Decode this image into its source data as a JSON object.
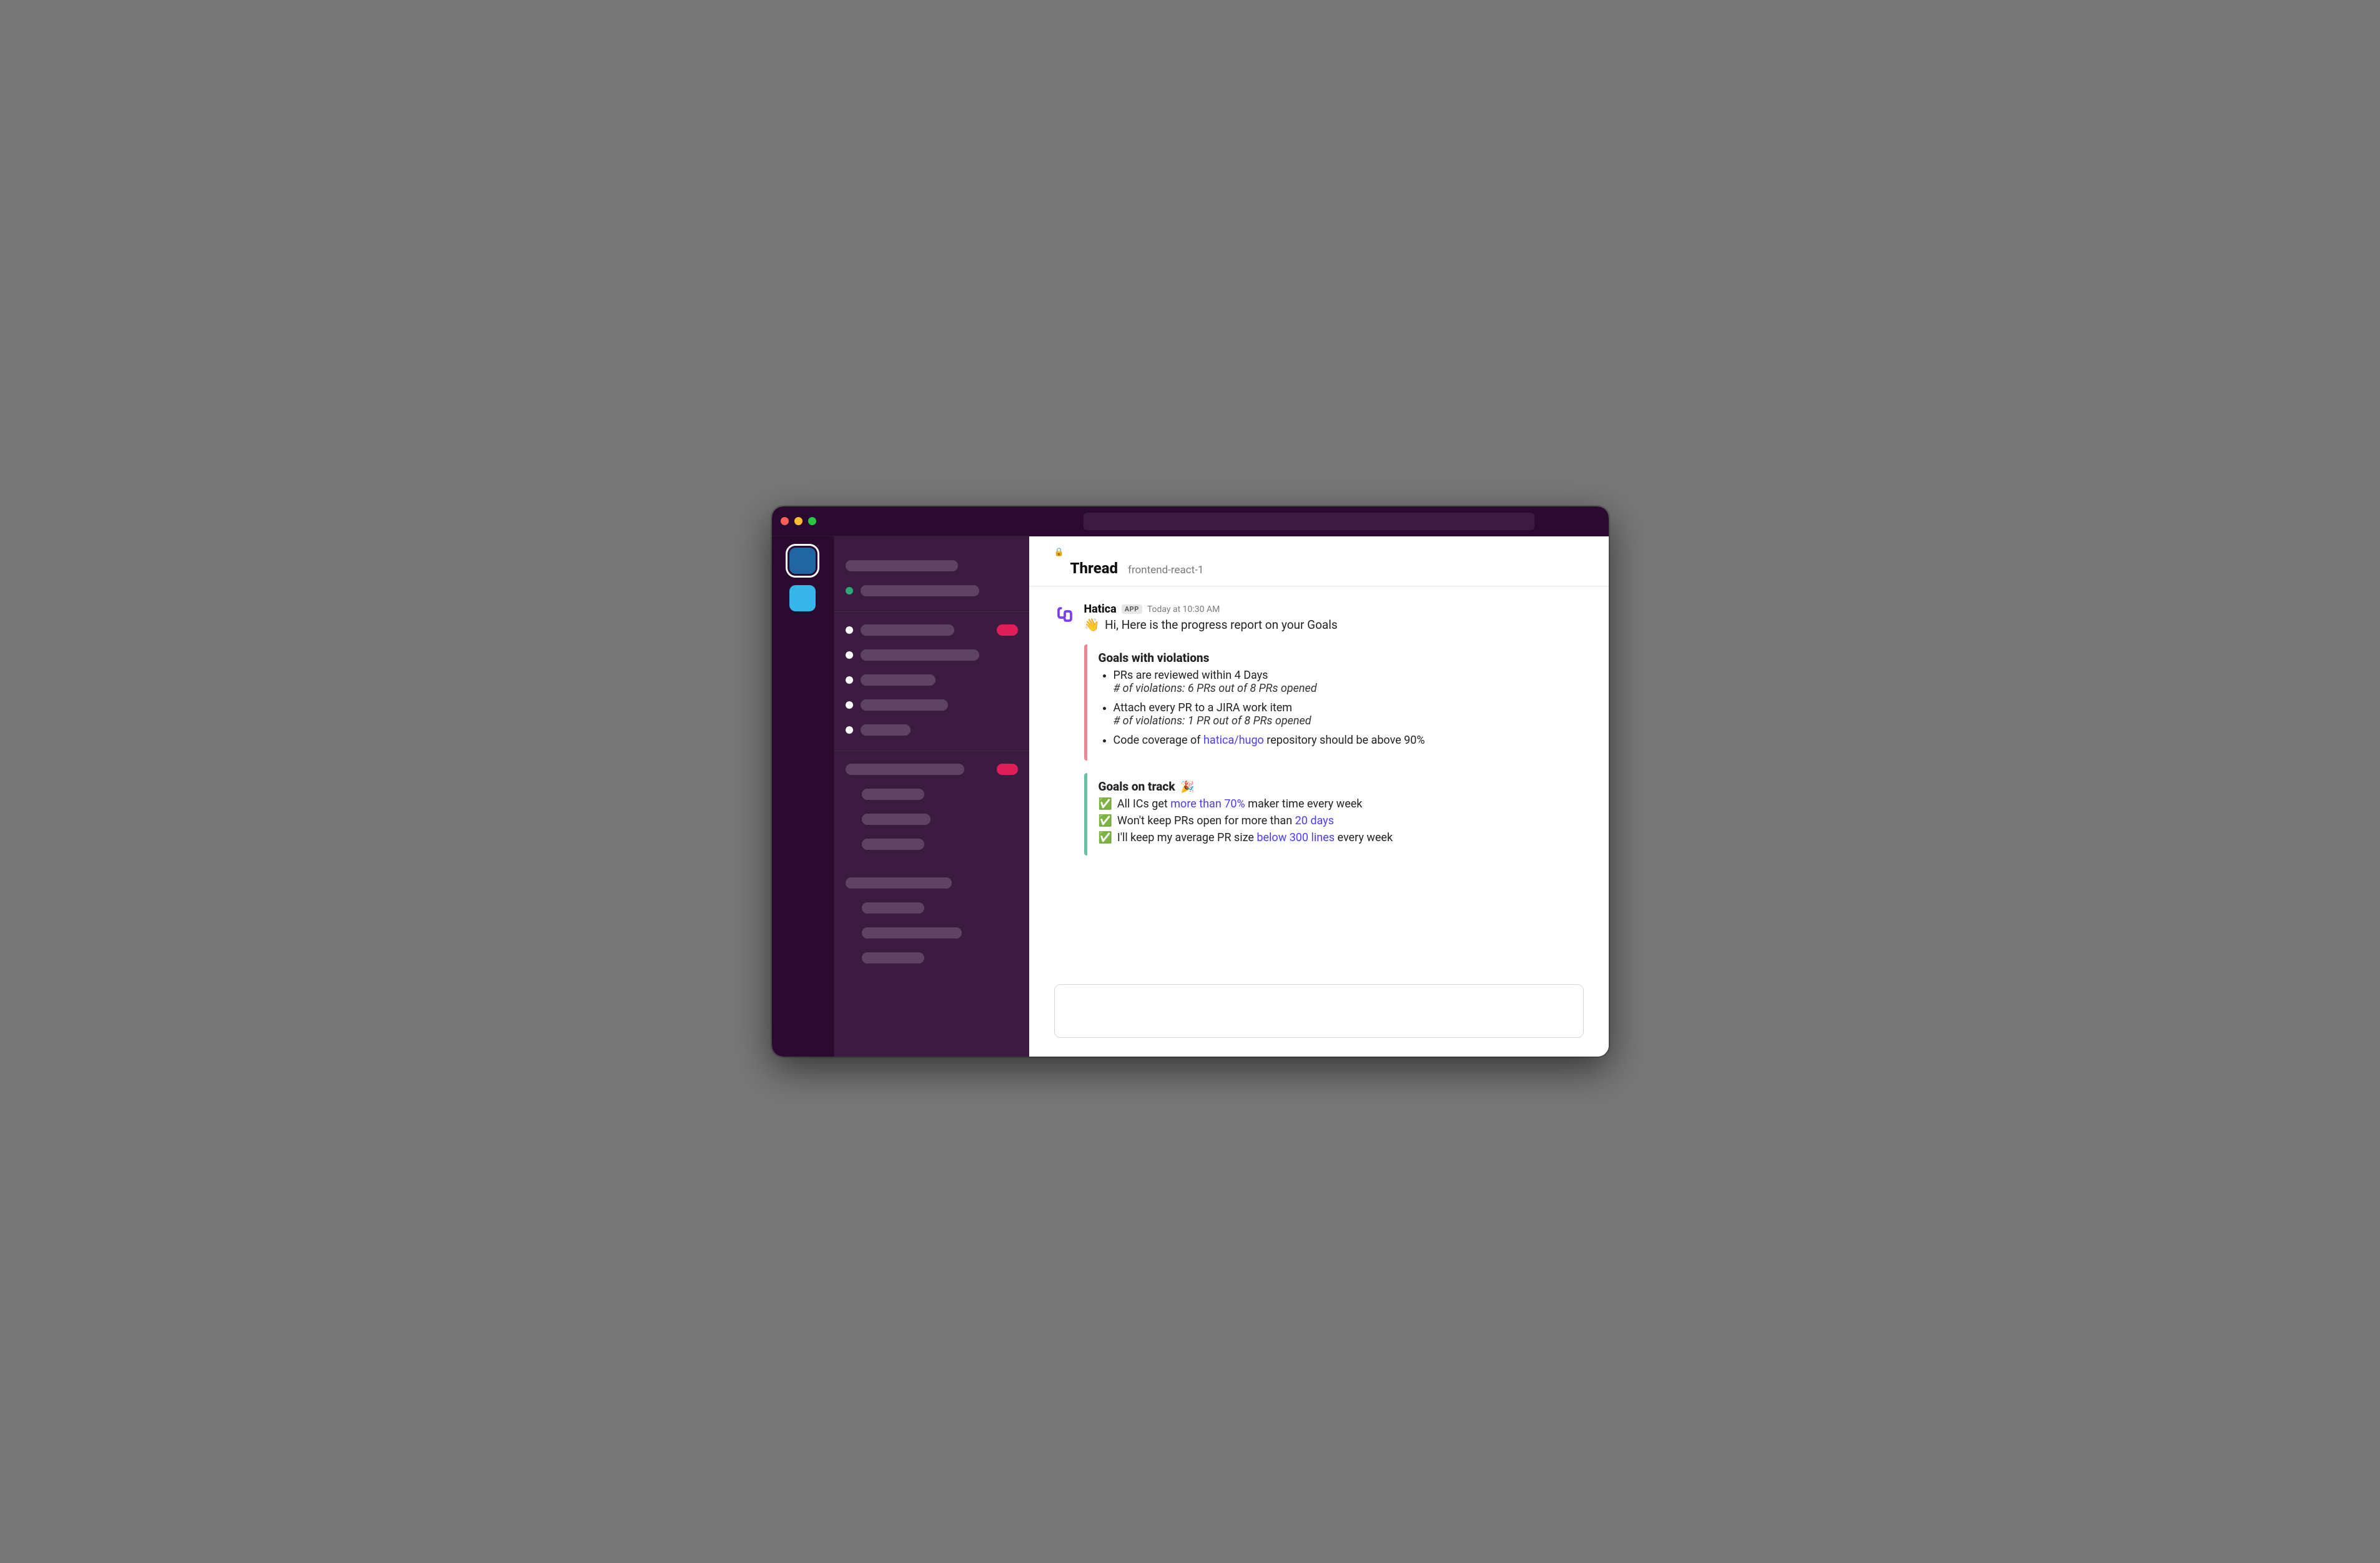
{
  "thread": {
    "title": "Thread",
    "channel": "frontend-react-1"
  },
  "message": {
    "sender": "Hatica",
    "app_badge": "APP",
    "timestamp": "Today at 10:30 AM",
    "greeting": "Hi, Here is the progress report on your Goals",
    "violations": {
      "heading": "Goals with violations",
      "items": [
        {
          "text": "PRs are reviewed within 4 Days",
          "sub_prefix": "# of violations:",
          "sub_value": "6 PRs out of 8 PRs opened"
        },
        {
          "text": "Attach every PR to a JIRA work item",
          "sub_prefix": "# of violations:",
          "sub_value": "1 PR out of 8 PRs opened"
        },
        {
          "pre": "Code coverage of ",
          "link": "hatica/hugo",
          "post": " repository should be above 90%"
        }
      ]
    },
    "ontrack": {
      "heading": "Goals on track",
      "items": [
        {
          "pre": "All ICs get ",
          "link": "more than 70%",
          "post": " maker time  every week"
        },
        {
          "pre": "Won't keep PRs open for more  than ",
          "link": "20 days",
          "post": ""
        },
        {
          "pre": "I'll keep my average PR size ",
          "link": "below 300 lines",
          "post": " every week"
        }
      ]
    }
  },
  "composer": {
    "placeholder": ""
  },
  "colors": {
    "link": "#4b3cff",
    "violation_border": "#e78a94",
    "ontrack_border": "#6cbfa1"
  }
}
